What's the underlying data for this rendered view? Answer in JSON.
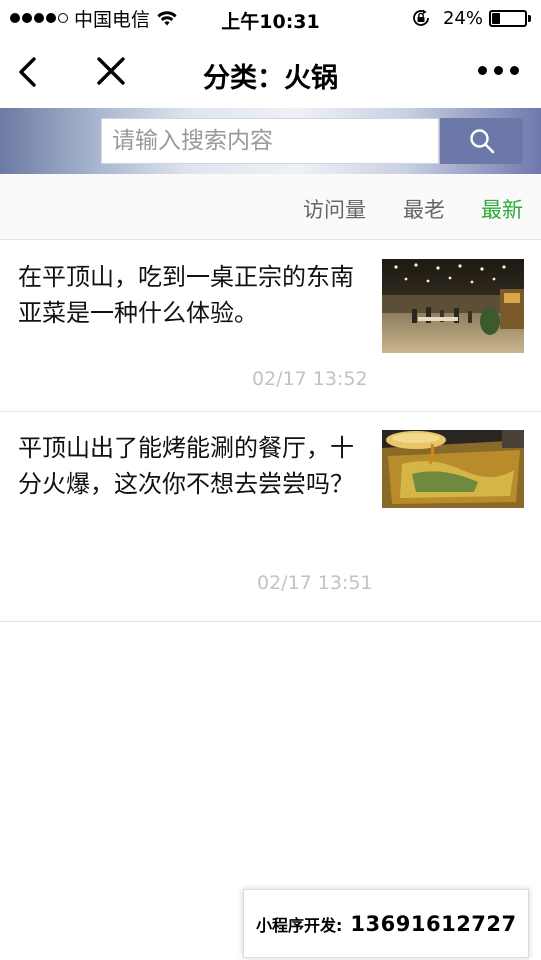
{
  "status_bar": {
    "carrier": "中国电信",
    "time": "上午10:31",
    "battery_percent_text": "24%",
    "battery_level": 0.24,
    "icons": [
      "signal-dots-icon",
      "wifi-icon",
      "rotation-lock-icon",
      "battery-icon"
    ]
  },
  "nav": {
    "title": "分类：火锅",
    "icons": [
      "back-chevron-icon",
      "close-icon",
      "more-dots-icon"
    ]
  },
  "search": {
    "placeholder": "请输入搜索内容",
    "button_icon": "search-icon"
  },
  "sort": {
    "options": [
      "访问量",
      "最老",
      "最新"
    ],
    "active": "最新"
  },
  "articles": [
    {
      "title": "在平顶山，吃到一桌正宗的东南亚菜是一种什么体验。",
      "time": "02/17 13:52",
      "thumb": "restaurant-hall-photo"
    },
    {
      "title": "平顶山出了能烤能涮的餐厅，十分火爆，这次你不想去尝尝吗？",
      "time": "02/17 13:51",
      "thumb": "hotpot-soup-photo"
    }
  ],
  "footer_badge": {
    "label": "小程序开发:",
    "phone": "13691612727"
  },
  "colors": {
    "active_sort": "#2eaa3c",
    "search_button": "#6c78a8",
    "timestamp": "#c2c2c2"
  }
}
